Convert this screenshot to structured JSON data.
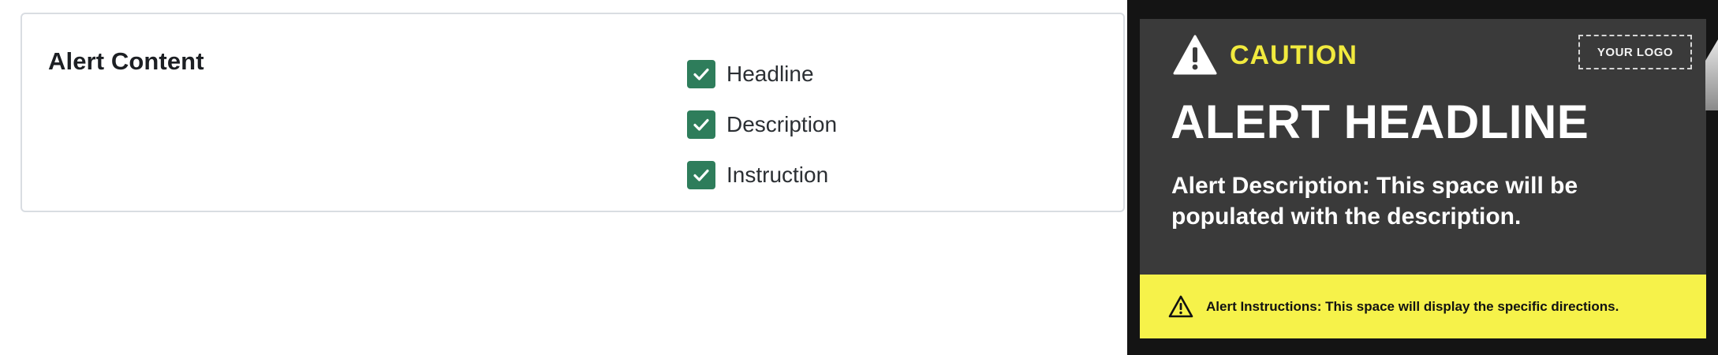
{
  "alert_content": {
    "title": "Alert Content",
    "options": [
      {
        "label": "Headline",
        "checked": true
      },
      {
        "label": "Description",
        "checked": true
      },
      {
        "label": "Instruction",
        "checked": true
      }
    ]
  },
  "preview": {
    "caution_label": "CAUTION",
    "logo_placeholder": "YOUR LOGO",
    "headline": "ALERT HEADLINE",
    "description": "Alert Description: This space will be populated with the description.",
    "instructions": "Alert Instructions: This space will display the specific directions.",
    "icons": {
      "caution": "warning-triangle-icon",
      "instructions": "warning-triangle-outline-icon"
    }
  },
  "colors": {
    "checkbox": "#2e7d5b",
    "caution_text": "#f1ea3e",
    "instructions_bar": "#f6f24a",
    "preview_background": "#3a3a3a"
  }
}
